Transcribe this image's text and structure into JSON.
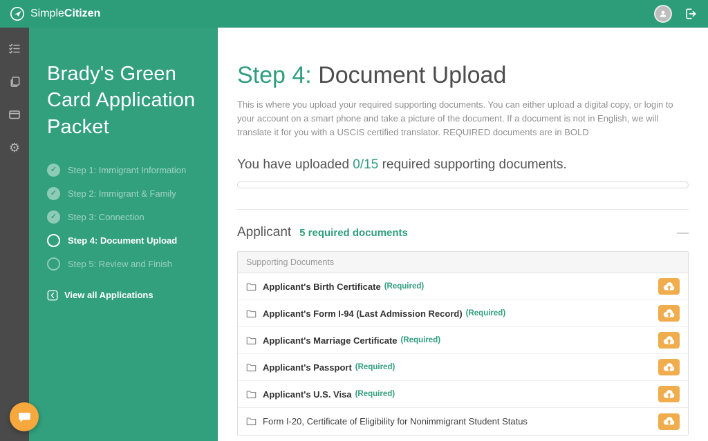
{
  "colors": {
    "brand_green": "#2d9c78",
    "sidebar_green": "#32a07d",
    "accent_green": "#2f9e7d",
    "upload_orange": "#f0ad4e",
    "chat_orange": "#f6a83c",
    "rail_gray": "#4a4a4a"
  },
  "icons": {
    "check": "✓",
    "gear": "⚙",
    "collapse": "—"
  },
  "topbar": {
    "brand_simple": "Simple",
    "brand_citizen": "Citizen"
  },
  "sidebar": {
    "title": "Brady's Green Card Application Packet",
    "steps": [
      {
        "label": "Step 1: Immigrant Information",
        "state": "done"
      },
      {
        "label": "Step 2: Immigrant & Family",
        "state": "done"
      },
      {
        "label": "Step 3: Connection",
        "state": "done"
      },
      {
        "label": "Step 4: Document Upload",
        "state": "current"
      },
      {
        "label": "Step 5: Review and Finish",
        "state": "todo"
      }
    ],
    "view_all_label": "View all Applications"
  },
  "main": {
    "title_prefix": "Step 4:",
    "title": "Document Upload",
    "description": "This is where you upload your required supporting documents. You can either upload a digital copy, or login to your account on a smart phone and take a picture of the document. If a document is not in English, we will translate it for you with a USCIS certified translator. REQUIRED documents are in BOLD",
    "uploaded_before": "You have uploaded",
    "uploaded_count": "0/15",
    "uploaded_after": "required supporting documents.",
    "progress_percent": 0,
    "section_label": "Applicant",
    "section_required": "5 required documents",
    "table": {
      "header": "Supporting Documents",
      "rows": [
        {
          "label": "Applicant's Birth Certificate",
          "required": "(Required)",
          "bold": true
        },
        {
          "label": "Applicant's Form I-94 (Last Admission Record)",
          "required": "(Required)",
          "bold": true
        },
        {
          "label": "Applicant's Marriage Certificate",
          "required": "(Required)",
          "bold": true
        },
        {
          "label": "Applicant's Passport",
          "required": "(Required)",
          "bold": true
        },
        {
          "label": "Applicant's U.S. Visa",
          "required": "(Required)",
          "bold": true
        },
        {
          "label": "Form I-20, Certificate of Eligibility for Nonimmigrant Student Status",
          "required": "",
          "bold": false
        }
      ]
    }
  }
}
